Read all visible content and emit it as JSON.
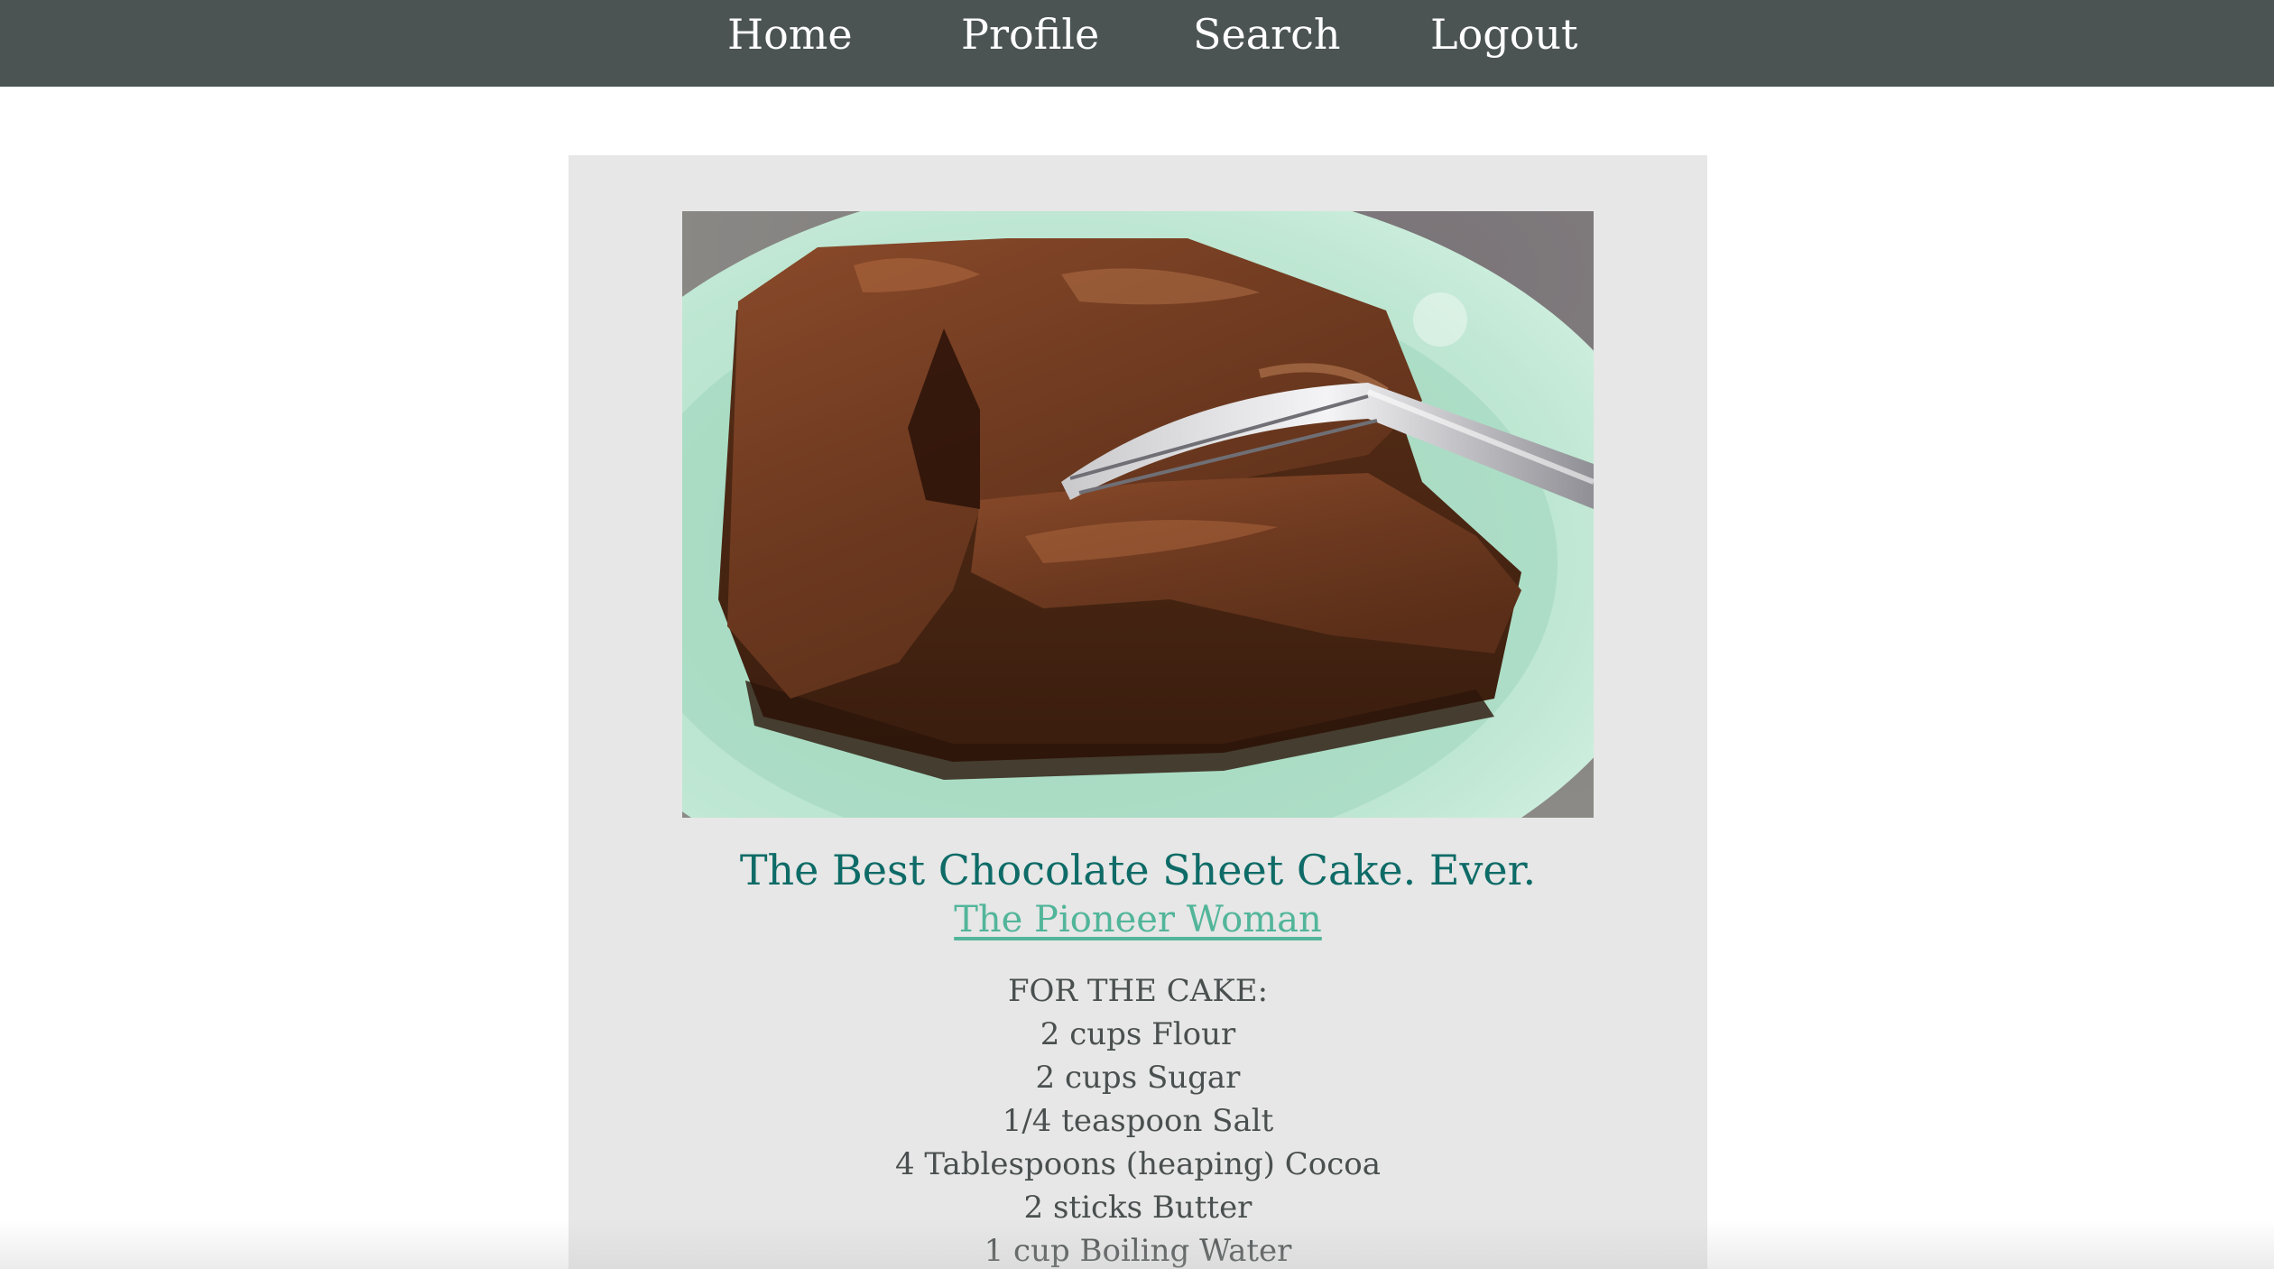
{
  "nav": {
    "items": [
      {
        "label": "Home"
      },
      {
        "label": "Profile"
      },
      {
        "label": "Search"
      },
      {
        "label": "Logout"
      }
    ]
  },
  "recipe": {
    "image_alt": "chocolate-sheet-cake-photo",
    "title": "The Best Chocolate Sheet Cake. Ever.",
    "source": "The Pioneer Woman",
    "ingredients": [
      "FOR THE CAKE:",
      "2 cups Flour",
      "2 cups Sugar",
      "1/4 teaspoon Salt",
      "4 Tablespoons (heaping) Cocoa",
      "2 sticks Butter",
      "1 cup Boiling Water"
    ]
  },
  "colors": {
    "navbar": "#4b5453",
    "card": "#e6e7e6",
    "title": "#0e6b67",
    "link": "#52b59a",
    "text": "#4a4f4f"
  }
}
